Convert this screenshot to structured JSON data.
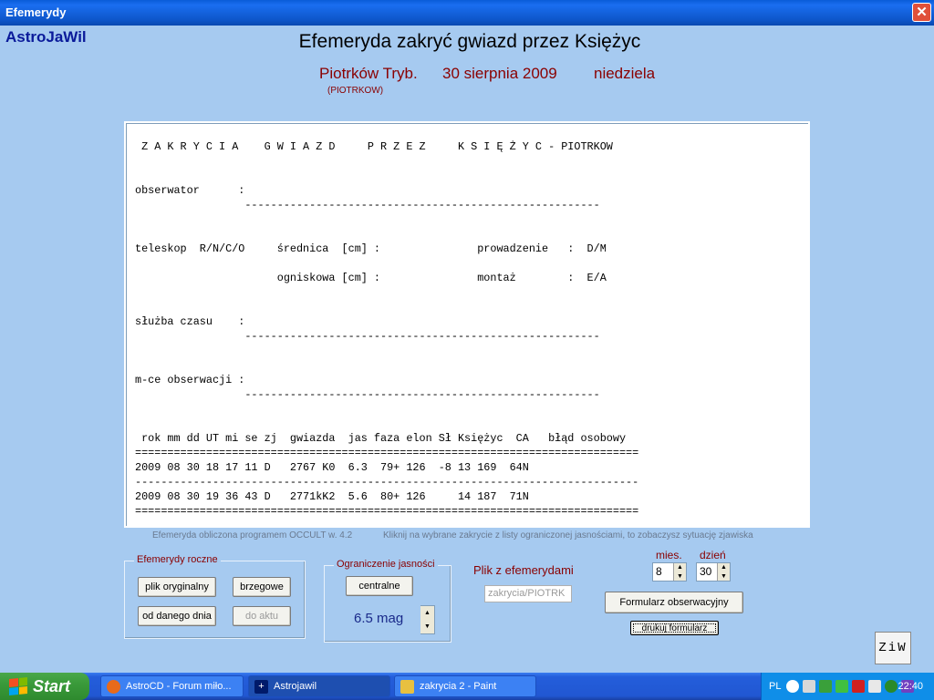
{
  "window": {
    "title": "Efemerydy"
  },
  "app": {
    "name": "AstroJaWil",
    "heading": "Efemeryda zakryć gwiazd przez Księżyc",
    "place": "Piotrków Tryb.",
    "date": "30 sierpnia 2009",
    "weekday": "niedziela",
    "code": "(PIOTRKOW)"
  },
  "report": {
    "text": " Z A K R Y C I A    G W I A Z D     P R Z E Z     K S I Ę Ż Y C - PIOTRKOW\n\n\nobserwator      :\n                 -------------------------------------------------------\n\n\nteleskop  R/N/C/O     średnica  [cm] :               prowadzenie   :  D/M\n\n                      ogniskowa [cm] :               montaż        :  E/A\n\n\nsłużba czasu    :\n                 -------------------------------------------------------\n\n\nm-ce obserwacji :\n                 -------------------------------------------------------\n\n\n rok mm dd UT mi se zj  gwiazda  jas faza elon Sł Księżyc  CA   błąd osobowy\n==============================================================================\n2009 08 30 18 17 11 D   2767 K0  6.3  79+ 126  -8 13 169  64N\n------------------------------------------------------------------------------\n2009 08 30 19 36 43 D   2771kK2  5.6  80+ 126     14 187  71N\n=============================================================================="
  },
  "info": {
    "left": "Efemeryda  obliczona programem OCCULT w. 4.2",
    "right": "Kliknij na wybrane zakrycie z listy ograniczonej jasnościami, to zobaczysz sytuację zjawiska"
  },
  "groups": {
    "roczne": {
      "legend": "Efemerydy roczne",
      "buttons": [
        "plik oryginalny",
        "brzegowe",
        "od danego dnia",
        "do aktu"
      ]
    },
    "jasnosc": {
      "legend": "Ograniczenie jasności",
      "button": "centralne",
      "value": "6.5 mag"
    }
  },
  "plik": {
    "label": "Plik z efemerydami",
    "value": "zakrycia/PIOTRK"
  },
  "date_select": {
    "month_label": "mies.",
    "month": "8",
    "day_label": "dzień",
    "day": "30"
  },
  "buttons": {
    "form": "Formularz obserwacyjny",
    "print": "drukuj formularz",
    "ziw": "ZiW"
  },
  "taskbar": {
    "start": "Start",
    "tasks": [
      "AstroCD - Forum miło...",
      "Astrojawil",
      "zakrycia 2 - Paint"
    ],
    "lang": "PL",
    "clock": "22:40"
  },
  "colors": {
    "background": "#a6caf0",
    "accent": "#8a0000",
    "title": "#0a1a9a"
  }
}
